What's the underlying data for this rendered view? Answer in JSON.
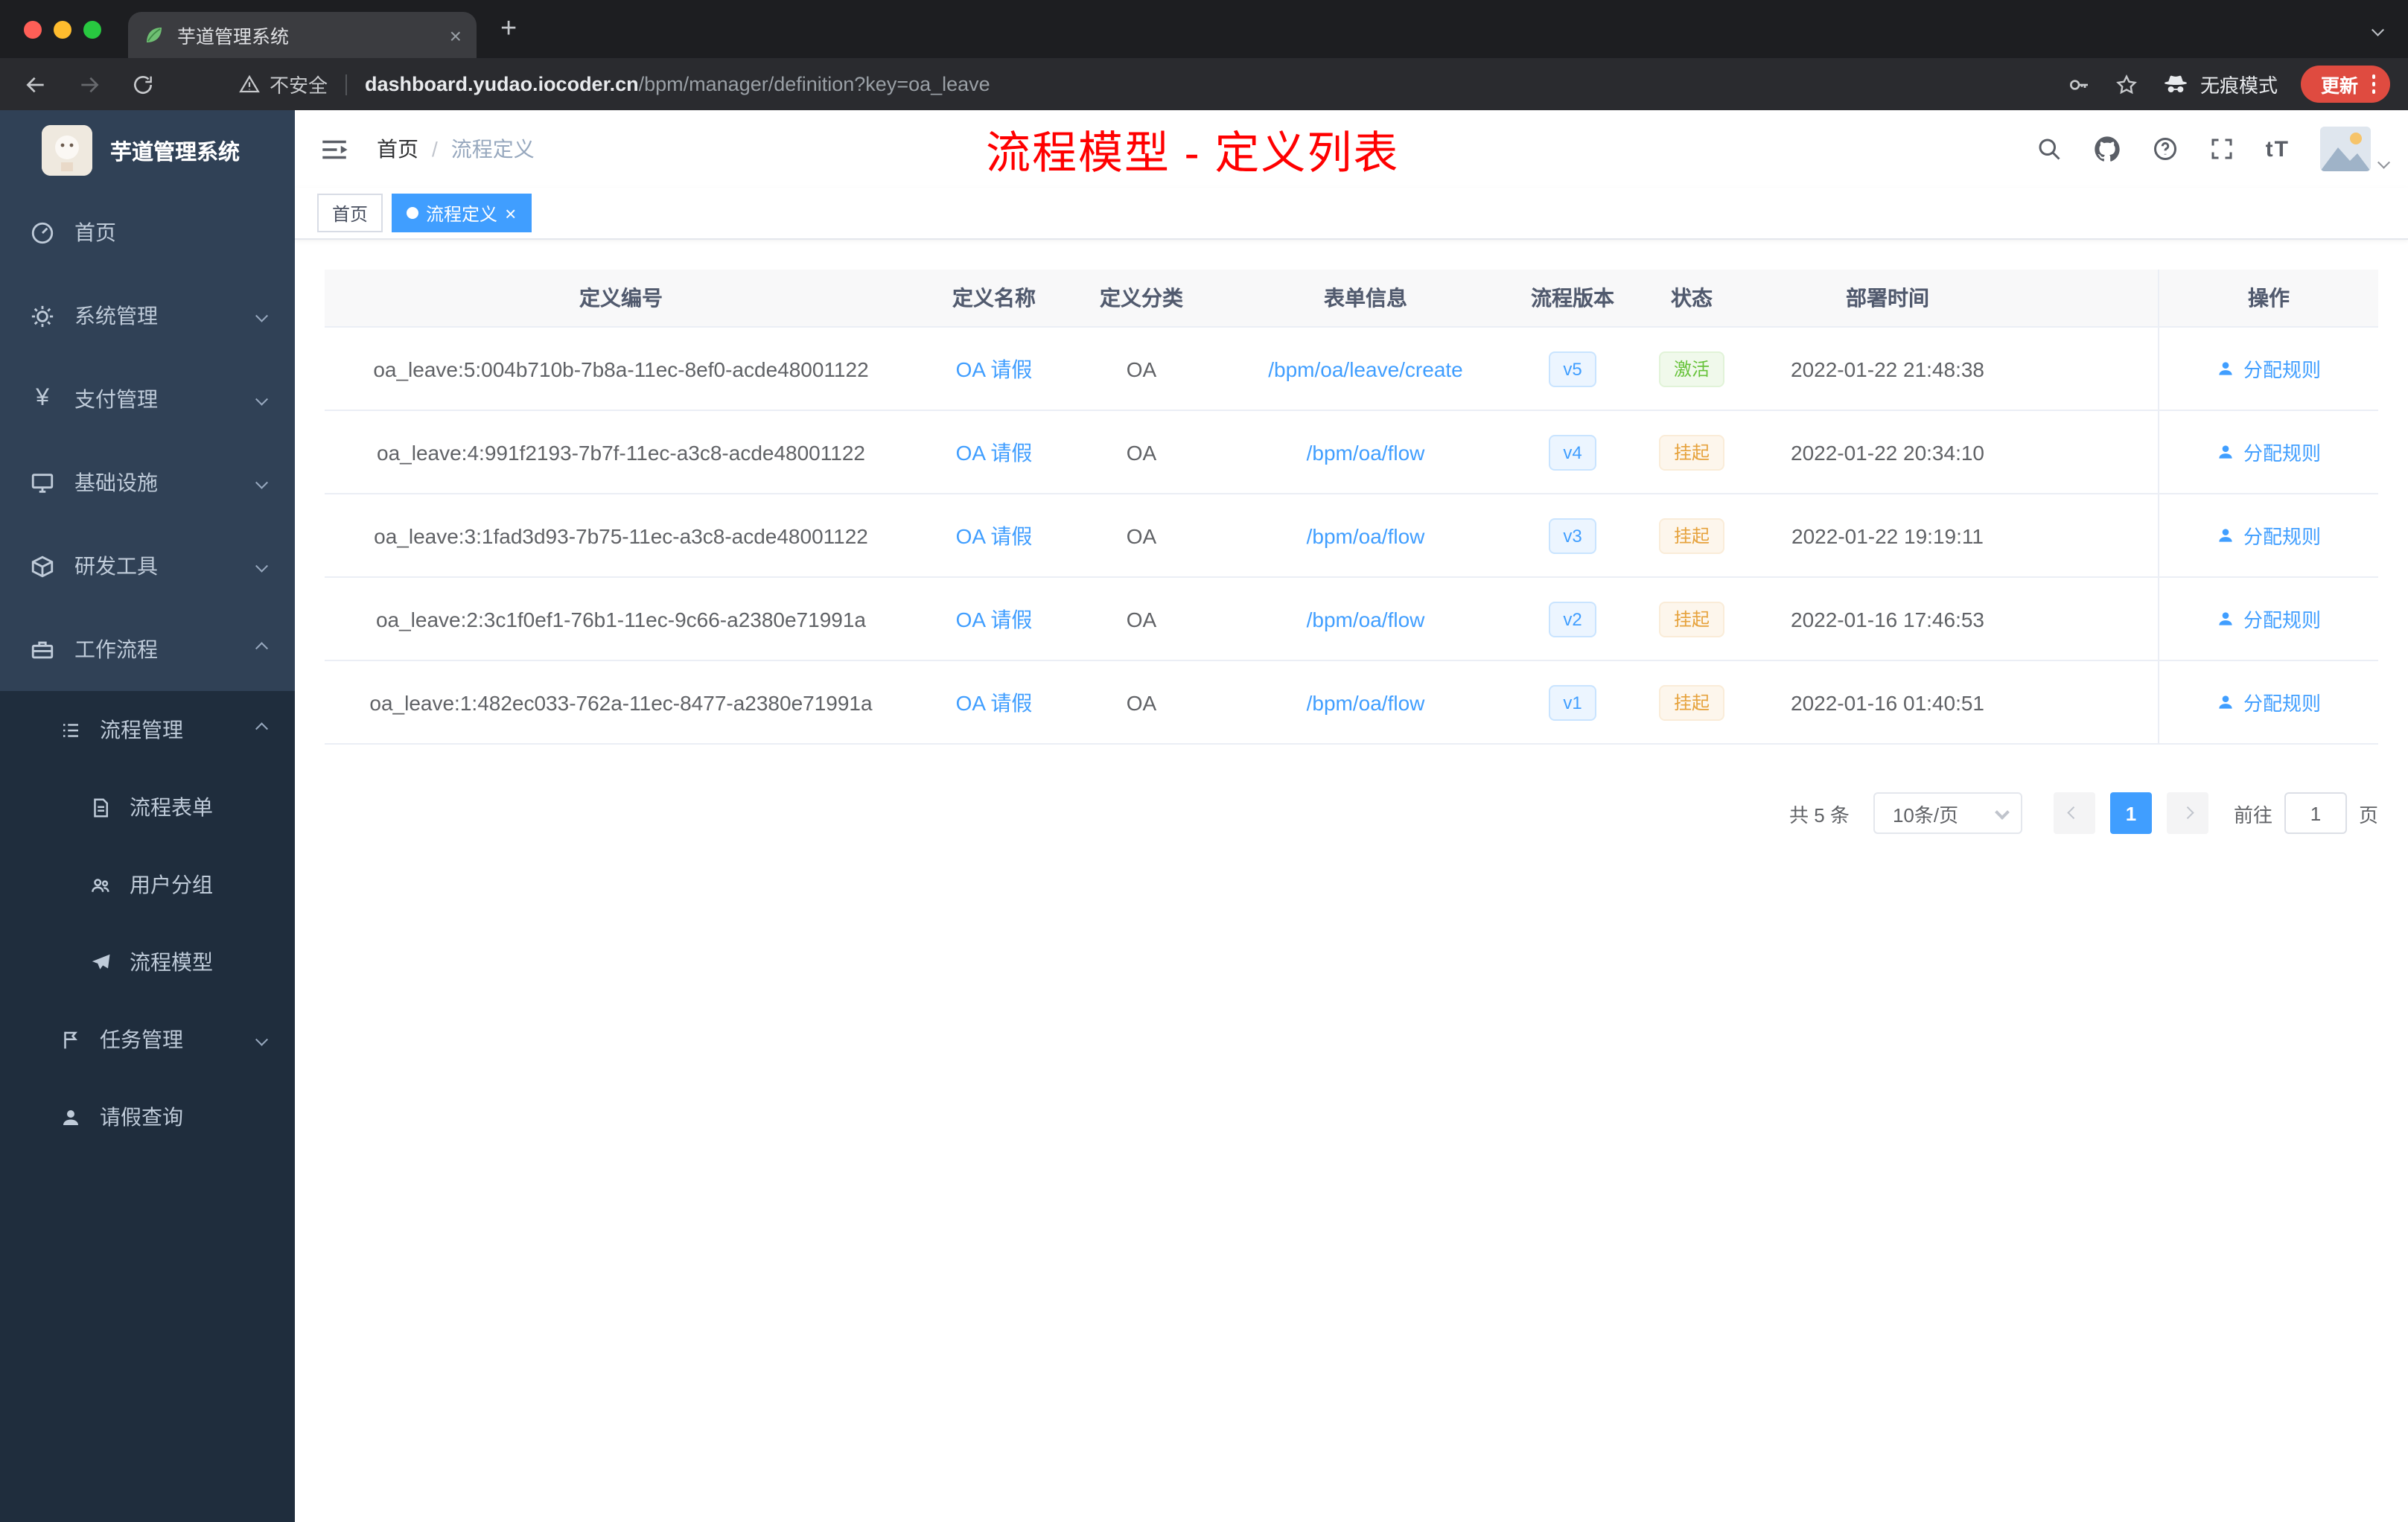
{
  "colors": {
    "accent": "#409eff",
    "success": "#67c23a",
    "warning": "#e6a23c",
    "annotation_red": "#ff0000",
    "sidebar_bg": "#304156",
    "sidebar_submenu_bg": "#1f2d3d",
    "update_pill": "#df4b40"
  },
  "browser": {
    "tab_title": "芋道管理系统",
    "security_label": "不安全",
    "url_domain": "dashboard.yudao.iocoder.cn",
    "url_path": "/bpm/manager/definition?key=oa_leave",
    "incognito_label": "无痕模式",
    "update_label": "更新"
  },
  "sidebar": {
    "logo_title": "芋道管理系统",
    "items": [
      {
        "label": "首页"
      },
      {
        "label": "系统管理"
      },
      {
        "label": "支付管理"
      },
      {
        "label": "基础设施"
      },
      {
        "label": "研发工具"
      },
      {
        "label": "工作流程"
      },
      {
        "label": "流程管理"
      },
      {
        "label": "流程表单"
      },
      {
        "label": "用户分组"
      },
      {
        "label": "流程模型"
      },
      {
        "label": "任务管理"
      },
      {
        "label": "请假查询"
      }
    ]
  },
  "navbar": {
    "breadcrumb_home": "首页",
    "breadcrumb_sep": "/",
    "breadcrumb_current": "流程定义",
    "annotation": "流程模型 - 定义列表",
    "font_size_icon": "tT"
  },
  "tags": {
    "home": "首页",
    "active": "流程定义"
  },
  "table": {
    "columns": [
      "定义编号",
      "定义名称",
      "定义分类",
      "表单信息",
      "流程版本",
      "状态",
      "部署时间",
      "操作"
    ],
    "action_label": "分配规则",
    "rows": [
      {
        "id": "oa_leave:5:004b710b-7b8a-11ec-8ef0-acde48001122",
        "name": "OA 请假",
        "category": "OA",
        "form": "/bpm/oa/leave/create",
        "version": "v5",
        "status": "激活",
        "deployed": "2022-01-22 21:48:38"
      },
      {
        "id": "oa_leave:4:991f2193-7b7f-11ec-a3c8-acde48001122",
        "name": "OA 请假",
        "category": "OA",
        "form": "/bpm/oa/flow",
        "version": "v4",
        "status": "挂起",
        "deployed": "2022-01-22 20:34:10"
      },
      {
        "id": "oa_leave:3:1fad3d93-7b75-11ec-a3c8-acde48001122",
        "name": "OA 请假",
        "category": "OA",
        "form": "/bpm/oa/flow",
        "version": "v3",
        "status": "挂起",
        "deployed": "2022-01-22 19:19:11"
      },
      {
        "id": "oa_leave:2:3c1f0ef1-76b1-11ec-9c66-a2380e71991a",
        "name": "OA 请假",
        "category": "OA",
        "form": "/bpm/oa/flow",
        "version": "v2",
        "status": "挂起",
        "deployed": "2022-01-16 17:46:53"
      },
      {
        "id": "oa_leave:1:482ec033-762a-11ec-8477-a2380e71991a",
        "name": "OA 请假",
        "category": "OA",
        "form": "/bpm/oa/flow",
        "version": "v1",
        "status": "挂起",
        "deployed": "2022-01-16 01:40:51"
      }
    ]
  },
  "pagination": {
    "total": "共 5 条",
    "page_size": "10条/页",
    "current_page": "1",
    "goto_label": "前往",
    "goto_value": "1",
    "goto_unit": "页"
  }
}
